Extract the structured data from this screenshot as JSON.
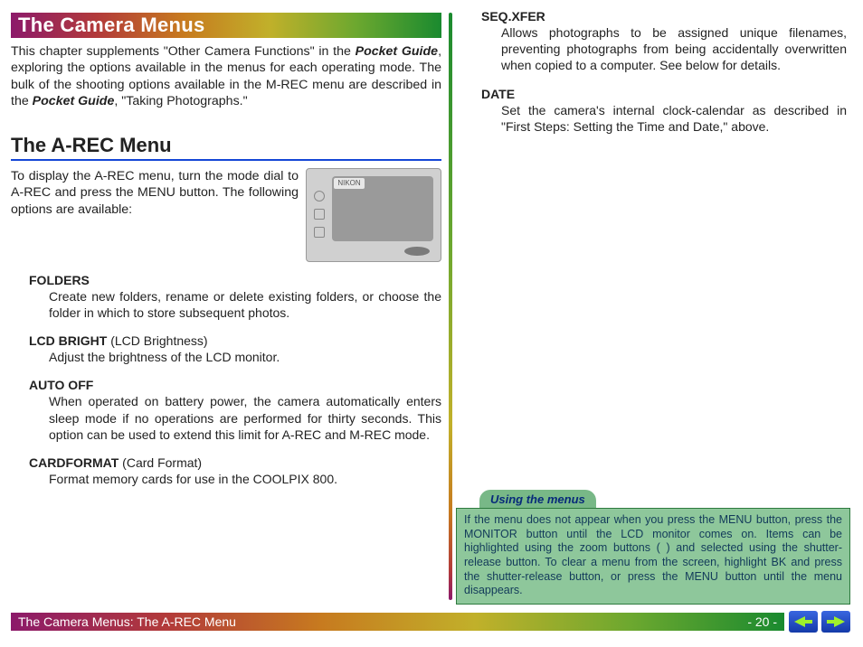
{
  "title": "The Camera Menus",
  "intro_before_em1": "This chapter supplements \"Other Camera Functions\" in the ",
  "intro_em1": "Pocket Guide",
  "intro_mid": ", exploring the options available in the menus for each operating mode.  The bulk of the shooting options available in the M-REC menu are described in the ",
  "intro_em2": "Pocket Guide",
  "intro_after": ", \"Taking Photographs.\"",
  "h2": "The A-REC Menu",
  "arec_intro": "To display the A-REC menu, turn the mode dial to A-REC and press the MENU button. The following options are available:",
  "cam_tab": "NIKON",
  "left_options": [
    {
      "heading": "FOLDERS",
      "sub": "",
      "body": "Create new folders, rename or delete existing folders, or choose the folder in which to store subsequent photos."
    },
    {
      "heading": "LCD BRIGHT",
      "sub": " (LCD Brightness)",
      "body": "Adjust the brightness of the LCD monitor."
    },
    {
      "heading": "AUTO OFF",
      "sub": "",
      "body": "When operated on battery power, the camera automatically enters sleep mode if no operations are performed for thirty seconds.  This option can be used to extend this limit for A-REC and M-REC mode."
    },
    {
      "heading": "CARDFORMAT",
      "sub": " (Card Format)",
      "body": "Format memory cards for use in the COOLPIX 800."
    }
  ],
  "right_options": [
    {
      "heading": "SEQ.XFER",
      "sub": "",
      "body": "Allows photographs to be assigned unique filenames, preventing photographs from being accidentally overwritten when copied to a computer.  See below for details."
    },
    {
      "heading": "DATE",
      "sub": "",
      "body": "Set the camera's internal clock-calendar as described in \"First Steps: Setting the Time and Date,\" above."
    }
  ],
  "callout_title": "Using the menus",
  "callout_body": "If the menu does not appear when you press the MENU button, press the MONITOR button until the LCD monitor comes on.  Items can be highlighted using the zoom buttons (      ) and selected using the shutter-release button.  To clear a menu from the screen, highlight BK and press the shutter-release button, or press the MENU button until the menu disappears.",
  "footer_left": "The Camera Menus: The A-REC Menu",
  "footer_page": "- 20 -"
}
